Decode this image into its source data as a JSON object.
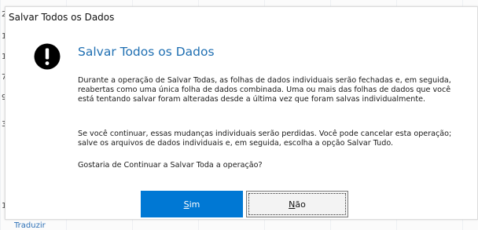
{
  "dialog": {
    "title": "Salvar Todos os Dados",
    "heading": "Salvar Todos os Dados",
    "paragraph1": "Durante a operação de Salvar Todas, as folhas de dados individuais serão fechadas e, em seguida, reabertas como uma única folha de dados combinada. Uma ou mais das folhas de dados que você está tentando salvar foram alteradas desde a última vez que foram salvas individualmente.",
    "paragraph2": "Se você continuar, essas mudanças individuais serão perdidas. Você pode cancelar esta operação; salve os arquivos de dados individuais e, em seguida, escolha a opção Salvar Tudo.",
    "question": "Gostaria de Continuar a Salvar Toda a operação?",
    "yes_mnemonic": "S",
    "yes_rest": "im",
    "no_mnemonic": "N",
    "no_rest": "ão",
    "icon": "exclamation-icon",
    "accent_color": "#0078d4",
    "heading_color": "#1f6fb2"
  },
  "background": {
    "row_numbers": [
      "2",
      "1",
      "1",
      "7",
      "9",
      "3",
      "1"
    ],
    "footer_link": "Traduzir"
  }
}
